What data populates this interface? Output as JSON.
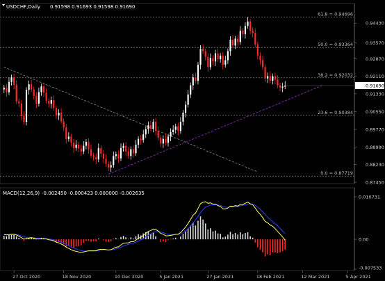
{
  "header": {
    "symbol": "USDCHF,Daily",
    "ohlc": "0.91598 0.91693 0.91598 0.91690"
  },
  "macd_header": {
    "label": "MACD(12,26,9)",
    "values": "-0.002450 -0.000423 0.000000 -0.002635"
  },
  "colors": {
    "background": "#000000",
    "bull_candle": "#ffffff",
    "bear_candle": "#ff2a2a",
    "fib_line": "#9e9e9e",
    "macd_line": "#ffff66",
    "signal_line": "#2a3bff",
    "trend_down": "#8a8a8a",
    "trend_up": "#9a33cc",
    "price_box": "#ffffff"
  },
  "chart_data": [
    {
      "type": "candlestick",
      "title": "USDCHF,Daily",
      "ylim": [
        0.8745,
        0.952
      ],
      "y_ticks": [
        "0.94430",
        "0.93570",
        "0.92870",
        "0.92110",
        "0.91330",
        "0.90550",
        "0.89770",
        "0.88990",
        "0.88230",
        "0.87450"
      ],
      "x_ticks": [
        "27 Oct 2020",
        "18 Nov 2020",
        "10 Dec 2020",
        "5 Jan 2021",
        "27 Jan 2021",
        "18 Feb 2021",
        "12 Mar 2021",
        "5 Apr 2021"
      ],
      "last_price": "0.91690",
      "fib_levels": [
        {
          "label": "61.8 = 0.94696",
          "value": 0.94696
        },
        {
          "label": "50.0 = 0.93364",
          "value": 0.93364
        },
        {
          "label": "38.2 = 0.92032",
          "value": 0.92032
        },
        {
          "label": "23.6 = 0.90384",
          "value": 0.90384
        },
        {
          "label": "0.0 = 0.87719",
          "value": 0.87719
        }
      ],
      "trendlines": [
        {
          "name": "down",
          "from": {
            "i": 0,
            "v": 0.925
          },
          "to": {
            "i": 102,
            "v": 0.879
          }
        },
        {
          "name": "up",
          "from": {
            "i": 42,
            "v": 0.878
          },
          "to": {
            "i": 128,
            "v": 0.917
          }
        }
      ],
      "closes": [
        0.916,
        0.914,
        0.9185,
        0.9205,
        0.9172,
        0.91,
        0.909,
        0.9035,
        0.901,
        0.915,
        0.9175,
        0.9152,
        0.9124,
        0.909,
        0.914,
        0.9165,
        0.9138,
        0.9102,
        0.9089,
        0.9105,
        0.907,
        0.9038,
        0.905,
        0.9012,
        0.8985,
        0.8935,
        0.8945,
        0.8918,
        0.8895,
        0.891,
        0.8893,
        0.888,
        0.8905,
        0.8922,
        0.889,
        0.8862,
        0.8855,
        0.8845,
        0.8895,
        0.887,
        0.8848,
        0.8825,
        0.881,
        0.882,
        0.886,
        0.8868,
        0.885,
        0.8895,
        0.8905,
        0.888,
        0.886,
        0.889,
        0.8872,
        0.891,
        0.8935,
        0.893,
        0.8955,
        0.8978,
        0.8995,
        0.898,
        0.901,
        0.897,
        0.894,
        0.8915,
        0.8935,
        0.8918,
        0.8945,
        0.8965,
        0.8975,
        0.899,
        0.897,
        0.901,
        0.905,
        0.9085,
        0.913,
        0.917,
        0.9205,
        0.919,
        0.926,
        0.933,
        0.932,
        0.9295,
        0.925,
        0.929,
        0.9275,
        0.931,
        0.9285,
        0.93,
        0.926,
        0.928,
        0.932,
        0.937,
        0.9345,
        0.9375,
        0.936,
        0.941,
        0.9395,
        0.943,
        0.945,
        0.941,
        0.94,
        0.935,
        0.93,
        0.928,
        0.925,
        0.92,
        0.921,
        0.919,
        0.921,
        0.9195,
        0.917,
        0.916,
        0.9165,
        0.9169
      ],
      "macd_ylim": [
        -0.00753,
        0.01073
      ],
      "macd_ticks": [
        "0.010731",
        "0.00",
        "-0.007533"
      ],
      "macd_hist": [
        0.0009,
        0.0008,
        0.0011,
        0.0013,
        0.0012,
        0.0008,
        0.0004,
        -0.0001,
        -0.0004,
        0.0002,
        0.0005,
        0.0004,
        0.0002,
        -0.0001,
        0.0002,
        0.0004,
        0.0003,
        0.0001,
        -0.0002,
        -0.0001,
        -0.0004,
        -0.0008,
        -0.0007,
        -0.001,
        -0.0013,
        -0.0019,
        -0.0017,
        -0.002,
        -0.0022,
        -0.0018,
        -0.0017,
        -0.0015,
        -0.0009,
        -0.0004,
        -0.0004,
        -0.0006,
        -0.0005,
        -0.0005,
        0.0002,
        0.0,
        -0.0002,
        -0.0006,
        -0.0007,
        -0.0005,
        0.0001,
        0.0003,
        0.0001,
        0.0006,
        0.0009,
        0.0005,
        0.0001,
        0.0005,
        0.0002,
        0.0008,
        0.0013,
        0.001,
        0.0015,
        0.0018,
        0.0019,
        0.0014,
        0.0017,
        0.0008,
        0.0,
        -0.0007,
        -0.0005,
        -0.0007,
        -0.0002,
        0.0001,
        0.0002,
        0.0004,
        0.0,
        0.0007,
        0.0014,
        0.002,
        0.0028,
        0.0035,
        0.0042,
        0.0035,
        0.0047,
        0.0058,
        0.005,
        0.004,
        0.0025,
        0.0028,
        0.002,
        0.0022,
        0.0015,
        0.0014,
        0.0005,
        0.0007,
        0.0012,
        0.0019,
        0.0013,
        0.0016,
        0.0012,
        0.0018,
        0.0013,
        0.0016,
        0.0018,
        0.0008,
        0.0004,
        -0.0008,
        -0.002,
        -0.0026,
        -0.0033,
        -0.0043,
        -0.0038,
        -0.004,
        -0.0033,
        -0.0033,
        -0.0035,
        -0.0033,
        -0.003,
        -0.0026
      ],
      "macd_line": [
        0.0012,
        0.0011,
        0.0012,
        0.0013,
        0.0013,
        0.0011,
        0.0008,
        0.0004,
        0.0001,
        0.0002,
        0.0003,
        0.0004,
        0.0003,
        0.0001,
        0.0001,
        0.0002,
        0.0002,
        0.0001,
        -0.0001,
        -0.0002,
        -0.0004,
        -0.0007,
        -0.0009,
        -0.0012,
        -0.0015,
        -0.002,
        -0.0023,
        -0.0026,
        -0.0029,
        -0.003,
        -0.0032,
        -0.0033,
        -0.0032,
        -0.003,
        -0.0029,
        -0.0029,
        -0.0029,
        -0.0029,
        -0.0026,
        -0.0025,
        -0.0025,
        -0.0026,
        -0.0027,
        -0.0026,
        -0.0023,
        -0.002,
        -0.0019,
        -0.0014,
        -0.001,
        -0.0009,
        -0.0009,
        -0.0006,
        -0.0006,
        -0.0002,
        0.0003,
        0.0005,
        0.001,
        0.0015,
        0.002,
        0.0022,
        0.0026,
        0.0025,
        0.0021,
        0.0015,
        0.0013,
        0.0009,
        0.0009,
        0.001,
        0.0011,
        0.0013,
        0.0013,
        0.0017,
        0.0024,
        0.0031,
        0.004,
        0.005,
        0.0061,
        0.0066,
        0.0078,
        0.009,
        0.0094,
        0.0095,
        0.0091,
        0.0092,
        0.0089,
        0.0089,
        0.0085,
        0.0083,
        0.0077,
        0.0077,
        0.0079,
        0.0084,
        0.0083,
        0.0085,
        0.0084,
        0.0088,
        0.0088,
        0.0091,
        0.0094,
        0.009,
        0.0087,
        0.0079,
        0.007,
        0.0063,
        0.0055,
        0.0045,
        0.0042,
        0.0036,
        0.0033,
        0.0027,
        0.002,
        0.0013,
        0.0006,
        -0.0002
      ]
    }
  ]
}
